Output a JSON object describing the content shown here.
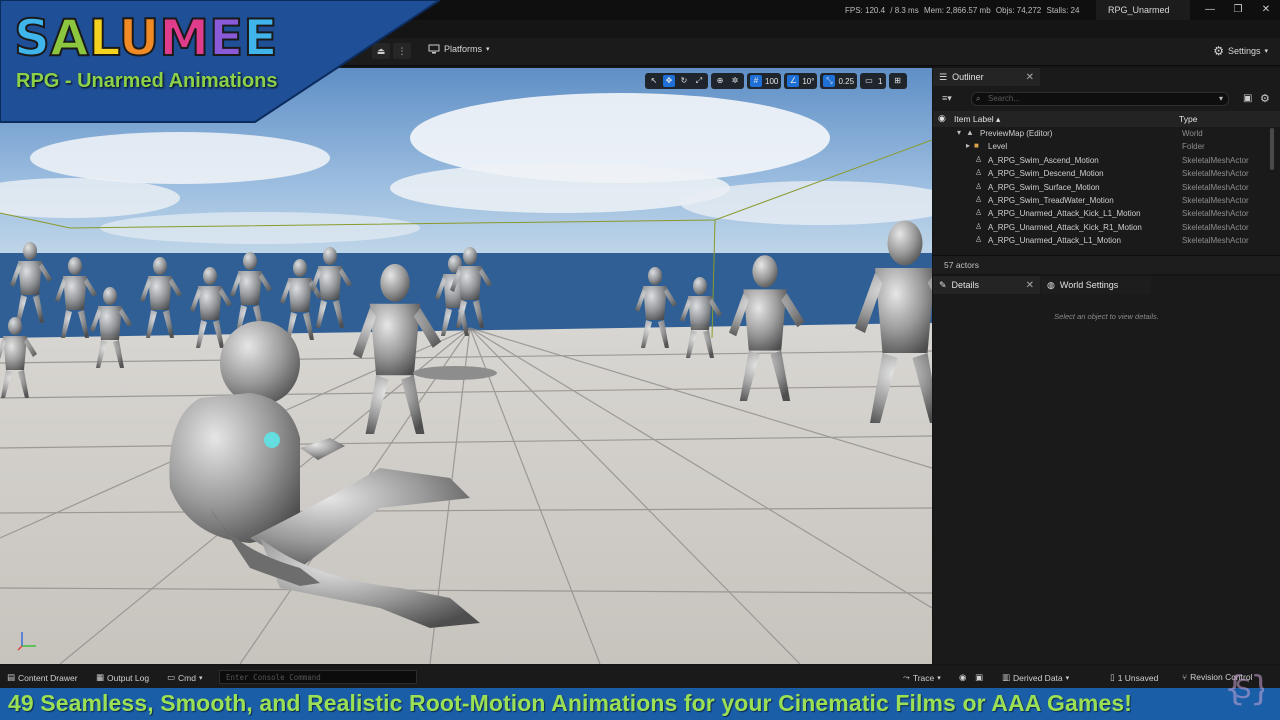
{
  "titlebar": {
    "stats": {
      "fps": "FPS: 120.4",
      "ms": "/ 8.3 ms",
      "mem": "Mem: 2,866.57 mb",
      "objs": "Objs: 74,272",
      "stalls": "Stalls: 24"
    },
    "project_tab": "RPG_Unarmed"
  },
  "toolbar": {
    "platforms_label": "Platforms",
    "settings_label": "Settings"
  },
  "viewport": {
    "grid_snap": "100",
    "rotation_snap": "10°",
    "scale_snap": "0.25",
    "camera_speed": "1"
  },
  "branding": {
    "logo_letters": [
      "S",
      "A",
      "L",
      "U",
      "M",
      "E",
      "E"
    ],
    "subtitle": "RPG - Unarmed Animations",
    "banner": "49 Seamless, Smooth, and Realistic Root-Motion Animations for your Cinematic Films or AAA Games!"
  },
  "outliner": {
    "tab_label": "Outliner",
    "search_placeholder": "Search...",
    "col_label": "Item Label ▴",
    "col_type": "Type",
    "rows": [
      {
        "label": "PreviewMap (Editor)",
        "type": "World"
      },
      {
        "label": "Level",
        "type": "Folder"
      },
      {
        "label": "A_RPG_Swim_Ascend_Motion",
        "type": "SkeletalMeshActor"
      },
      {
        "label": "A_RPG_Swim_Descend_Motion",
        "type": "SkeletalMeshActor"
      },
      {
        "label": "A_RPG_Swim_Surface_Motion",
        "type": "SkeletalMeshActor"
      },
      {
        "label": "A_RPG_Swim_TreadWater_Motion",
        "type": "SkeletalMeshActor"
      },
      {
        "label": "A_RPG_Unarmed_Attack_Kick_L1_Motion",
        "type": "SkeletalMeshActor"
      },
      {
        "label": "A_RPG_Unarmed_Attack_Kick_R1_Motion",
        "type": "SkeletalMeshActor"
      },
      {
        "label": "A_RPG_Unarmed_Attack_L1_Motion",
        "type": "SkeletalMeshActor"
      }
    ],
    "actor_count": "57 actors"
  },
  "details": {
    "tab_label": "Details",
    "world_settings_label": "World Settings",
    "empty_message": "Select an object to view details."
  },
  "bottombar": {
    "content_drawer": "Content Drawer",
    "output_log": "Output Log",
    "cmd": "Cmd",
    "console_placeholder": "Enter Console Command",
    "trace": "Trace",
    "derived_data": "Derived Data",
    "unsaved": "1 Unsaved",
    "revision_control": "Revision Control"
  },
  "colors": {
    "accent": "#1e6fd6",
    "banner_bg": "#1b5ea8",
    "banner_text": "#9be054"
  }
}
